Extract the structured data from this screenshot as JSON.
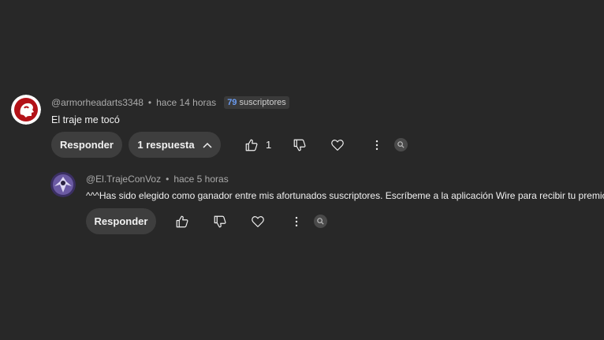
{
  "comments": [
    {
      "author": "@armorheadarts3348",
      "time": "hace 14 horas",
      "subscriber_count": "79",
      "subscriber_label": "suscriptores",
      "text": "El traje me tocó",
      "reply_label": "Responder",
      "replies_label": "1 respuesta",
      "like_count": "1"
    },
    {
      "author": "@El.TrajeConVoz",
      "time": "hace 5 horas",
      "text": "^^^Has sido elegido como ganador entre mis afortunados suscriptores. Escríbeme a la aplicación Wire para recibir tu premio.",
      "reply_label": "Responder"
    }
  ],
  "separator": "•",
  "colors": {
    "background": "#282828",
    "button": "#3e3e3e",
    "subscriber_accent": "#6b9cf2"
  }
}
